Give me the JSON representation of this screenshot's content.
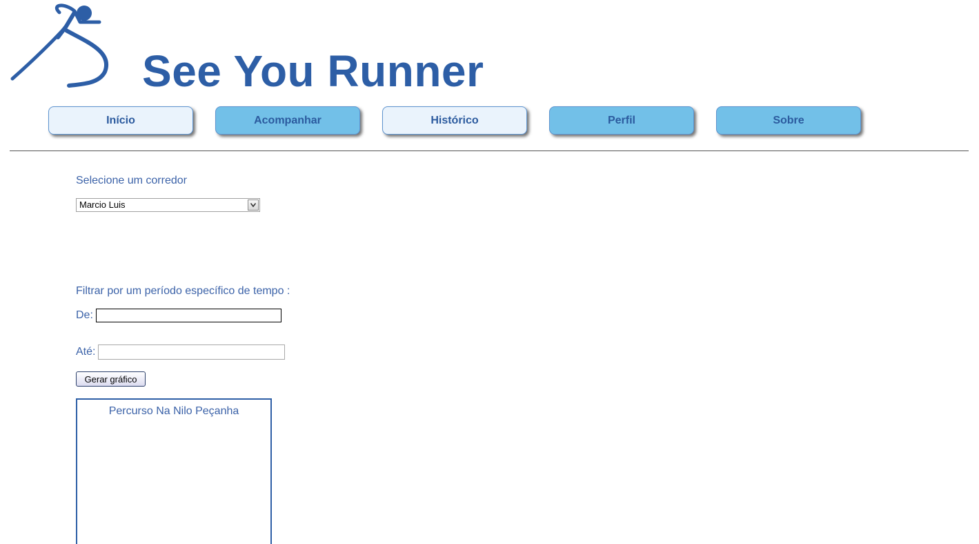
{
  "header": {
    "title": "See You Runner",
    "logo_icon": "runner-logo-icon",
    "accent_color": "#2d5ea6"
  },
  "nav": {
    "tabs": [
      {
        "label": "Início",
        "style": "light"
      },
      {
        "label": "Acompanhar",
        "style": "blue"
      },
      {
        "label": "Histórico",
        "style": "light"
      },
      {
        "label": "Perfil",
        "style": "blue"
      },
      {
        "label": "Sobre",
        "style": "blue"
      }
    ]
  },
  "runner_select": {
    "label": "Selecione um corredor",
    "selected_value": "Marcio Luis"
  },
  "filter": {
    "heading": "Filtrar por um período específico de tempo :",
    "from_label": "De:",
    "from_value": "",
    "to_label": "Até:",
    "to_value": ""
  },
  "generate_button": {
    "label": "Gerar gráfico"
  },
  "chart_panel": {
    "title": "Percurso Na Nilo Peçanha"
  }
}
